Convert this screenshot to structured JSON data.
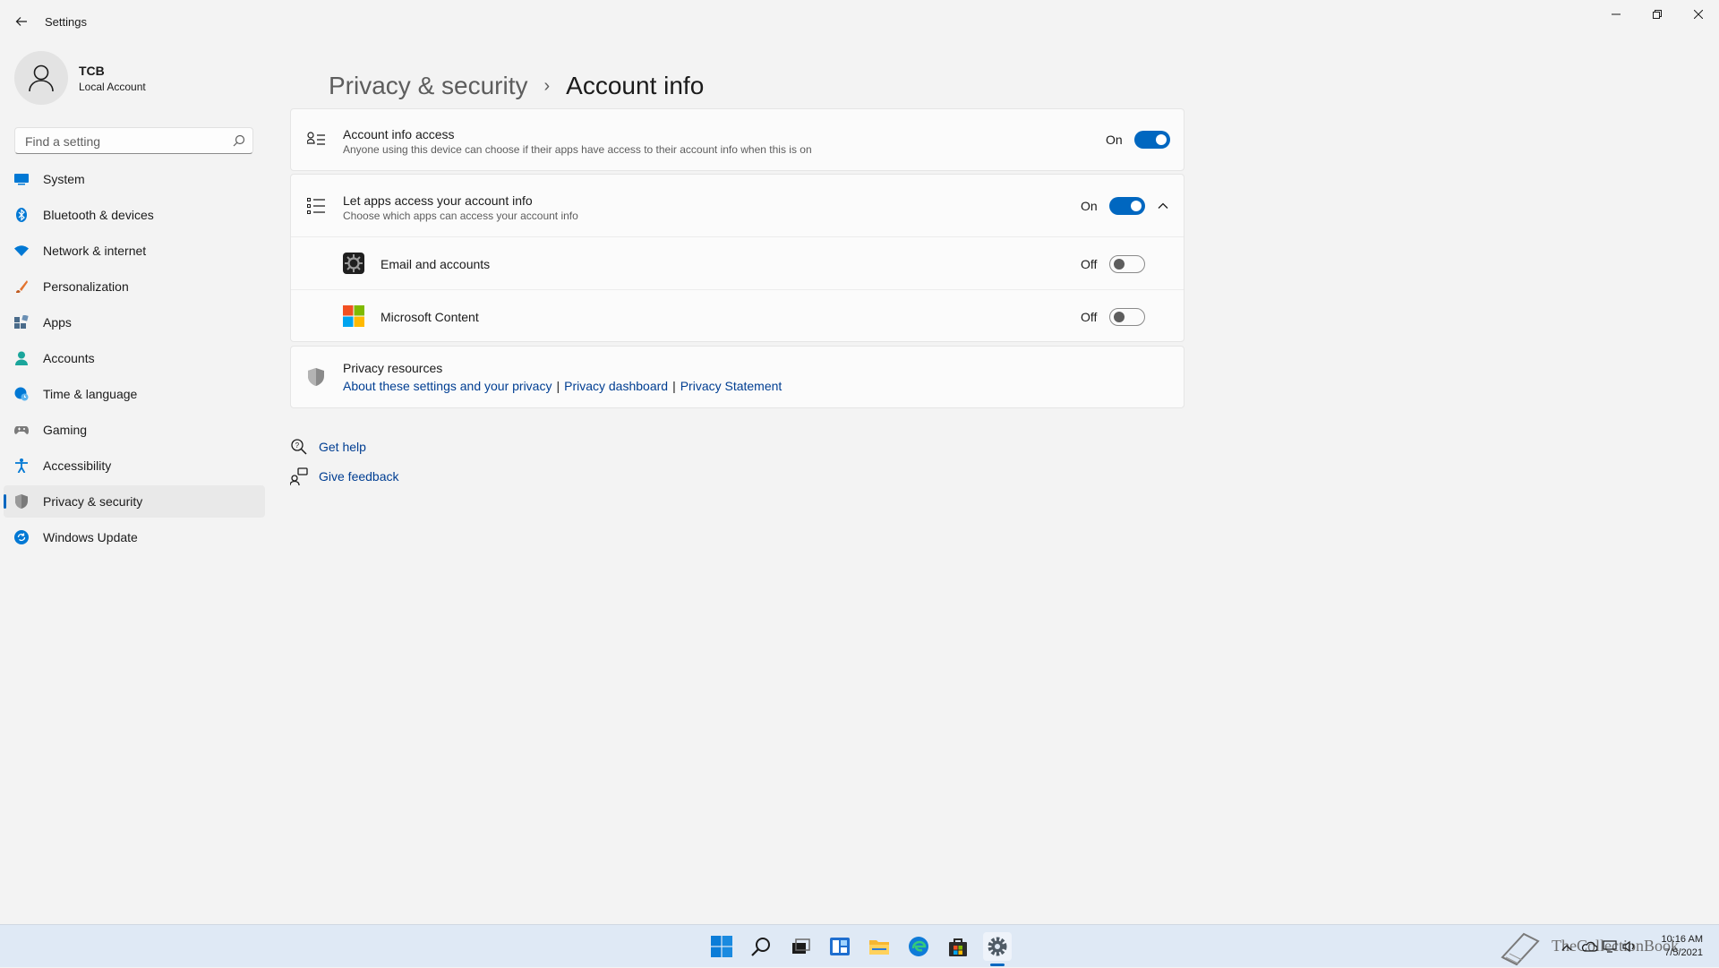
{
  "window": {
    "title": "Settings",
    "controls": [
      "minimize-icon",
      "restore-icon",
      "close-icon"
    ]
  },
  "profile": {
    "name": "TCB",
    "account_type": "Local Account"
  },
  "search": {
    "placeholder": "Find a setting",
    "value": ""
  },
  "sidebar": {
    "items": [
      {
        "label": "System",
        "icon": "system-icon",
        "color": "#0078d4"
      },
      {
        "label": "Bluetooth & devices",
        "icon": "bluetooth-icon",
        "color": "#0078d4"
      },
      {
        "label": "Network & internet",
        "icon": "wifi-icon",
        "color": "#0078d4"
      },
      {
        "label": "Personalization",
        "icon": "brush-icon",
        "color": "#e3742f"
      },
      {
        "label": "Apps",
        "icon": "apps-icon",
        "color": "#4a6b8a"
      },
      {
        "label": "Accounts",
        "icon": "person-icon",
        "color": "#1aa59b"
      },
      {
        "label": "Time & language",
        "icon": "globe-clock-icon",
        "color": "#0078d4"
      },
      {
        "label": "Gaming",
        "icon": "gamepad-icon",
        "color": "#7a7a7a"
      },
      {
        "label": "Accessibility",
        "icon": "accessibility-icon",
        "color": "#0078d4"
      },
      {
        "label": "Privacy & security",
        "icon": "shield-icon",
        "color": "#7a7a7a",
        "selected": true
      },
      {
        "label": "Windows Update",
        "icon": "update-icon",
        "color": "#0078d4"
      }
    ]
  },
  "breadcrumb": {
    "parent": "Privacy & security",
    "separator": "›",
    "current": "Account info"
  },
  "settings": {
    "account_info_access": {
      "title": "Account info access",
      "description": "Anyone using this device can choose if their apps have access to their account info when this is on",
      "state": "On",
      "enabled": true
    },
    "let_apps_access": {
      "title": "Let apps access your account info",
      "description": "Choose which apps can access your account info",
      "state": "On",
      "enabled": true,
      "expanded": true
    },
    "apps": [
      {
        "name": "Email and accounts",
        "state": "Off",
        "enabled": false,
        "icon": "email-accounts-icon"
      },
      {
        "name": "Microsoft Content",
        "state": "Off",
        "enabled": false,
        "icon": "microsoft-logo-icon"
      }
    ]
  },
  "privacy_resources": {
    "title": "Privacy resources",
    "links": [
      "About these settings and your privacy",
      "Privacy dashboard",
      "Privacy Statement"
    ]
  },
  "help": {
    "get_help": "Get help",
    "give_feedback": "Give feedback"
  },
  "taskbar": {
    "apps": [
      "start-icon",
      "search-icon",
      "task-view-icon",
      "widgets-icon",
      "file-explorer-icon",
      "edge-icon",
      "store-icon",
      "settings-icon"
    ],
    "active_app": "settings-icon",
    "watermark": "TheCollectionBook",
    "time": "10:16 AM",
    "date": "7/5/2021"
  },
  "colors": {
    "accent": "#0067c0",
    "link": "#003e92",
    "background": "#f3f3f3",
    "card": "#fbfbfb"
  }
}
